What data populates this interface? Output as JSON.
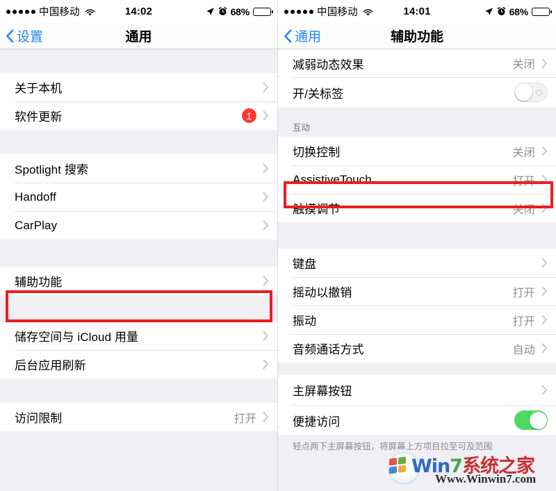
{
  "left": {
    "status": {
      "signal_dots": 5,
      "carrier": "中国移动",
      "wifi_icon": "wifi-icon",
      "time": "14:02",
      "location_icon": "location-arrow-icon",
      "alarm_icon": "alarm-clock-icon",
      "battery_percent": "68%",
      "battery_level": 68
    },
    "nav": {
      "back_label": "设置",
      "back_icon": "chevron-left-icon",
      "title": "通用"
    },
    "sections": [
      {
        "header": "",
        "rows": [
          {
            "label": "关于本机",
            "value": "",
            "badge": "",
            "accessory": "chevron"
          },
          {
            "label": "软件更新",
            "value": "",
            "badge": "1",
            "accessory": "chevron"
          }
        ]
      },
      {
        "header": "",
        "rows": [
          {
            "label": "Spotlight 搜索",
            "value": "",
            "badge": "",
            "accessory": "chevron"
          },
          {
            "label": "Handoff",
            "value": "",
            "badge": "",
            "accessory": "chevron"
          },
          {
            "label": "CarPlay",
            "value": "",
            "badge": "",
            "accessory": "chevron"
          }
        ]
      },
      {
        "header": "",
        "rows": [
          {
            "label": "辅助功能",
            "value": "",
            "badge": "",
            "accessory": "chevron",
            "highlighted": true
          }
        ]
      },
      {
        "header": "",
        "rows": [
          {
            "label": "储存空间与 iCloud 用量",
            "value": "",
            "badge": "",
            "accessory": "chevron"
          },
          {
            "label": "后台应用刷新",
            "value": "",
            "badge": "",
            "accessory": "chevron"
          }
        ]
      },
      {
        "header": "",
        "rows": [
          {
            "label": "访问限制",
            "value": "打开",
            "badge": "",
            "accessory": "chevron"
          }
        ]
      }
    ]
  },
  "right": {
    "status": {
      "signal_dots": 5,
      "carrier": "中国移动",
      "wifi_icon": "wifi-icon",
      "time": "14:01",
      "location_icon": "location-arrow-icon",
      "alarm_icon": "alarm-clock-icon",
      "battery_percent": "68%",
      "battery_level": 68
    },
    "nav": {
      "back_label": "通用",
      "back_icon": "chevron-left-icon",
      "title": "辅助功能"
    },
    "sections": [
      {
        "header": "",
        "rows": [
          {
            "label": "减弱动态效果",
            "value": "关闭",
            "accessory": "chevron"
          },
          {
            "label": "开/关标签",
            "value": "",
            "accessory": "toggle",
            "toggle_on": false
          }
        ]
      },
      {
        "header": "互动",
        "rows": [
          {
            "label": "切换控制",
            "value": "关闭",
            "accessory": "chevron"
          },
          {
            "label": "AssistiveTouch",
            "value": "打开",
            "accessory": "chevron",
            "highlighted": true
          },
          {
            "label": "触摸调节",
            "value": "关闭",
            "accessory": "chevron"
          }
        ]
      },
      {
        "header": "",
        "rows": [
          {
            "label": "键盘",
            "value": "",
            "accessory": "chevron"
          },
          {
            "label": "摇动以撤销",
            "value": "打开",
            "accessory": "chevron"
          },
          {
            "label": "振动",
            "value": "打开",
            "accessory": "chevron"
          },
          {
            "label": "音频通话方式",
            "value": "自动",
            "accessory": "chevron"
          }
        ]
      },
      {
        "header": "",
        "rows": [
          {
            "label": "主屏幕按钮",
            "value": "",
            "accessory": "chevron"
          },
          {
            "label": "便捷访问",
            "value": "",
            "accessory": "toggle",
            "toggle_on": true
          }
        ]
      }
    ],
    "footer_note": "轻点两下主屏幕按钮，将屏幕上方项目拉至可及范围"
  },
  "watermark": {
    "brand_win": "Win",
    "brand_seven": "7",
    "brand_cn": "系统之家",
    "url": "Www.Winwin7.com"
  },
  "colors": {
    "accent_blue": "#1f86f7",
    "badge_red": "#fc3b2e",
    "toggle_green": "#4cd862",
    "highlight_red": "#ee1d1d",
    "group_bg": "#efeff4"
  }
}
